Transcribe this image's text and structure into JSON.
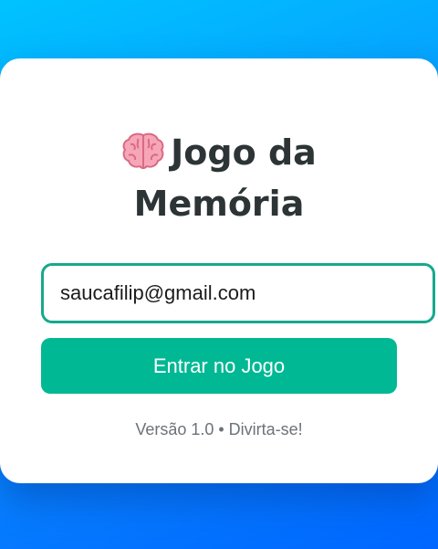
{
  "login": {
    "icon": "brain-icon",
    "title": "Jogo da Memória",
    "email_value": "saucafilip@gmail.com",
    "enter_button_label": "Entrar no Jogo",
    "version_text": "Versão 1.0 • Divirta-se!"
  },
  "colors": {
    "background_start": "#00c3ff",
    "background_end": "#0066ff",
    "card": "#ffffff",
    "accent": "#00b894",
    "input_border": "#16a98b",
    "title_text": "#2d3436",
    "muted_text": "#6b7378"
  }
}
